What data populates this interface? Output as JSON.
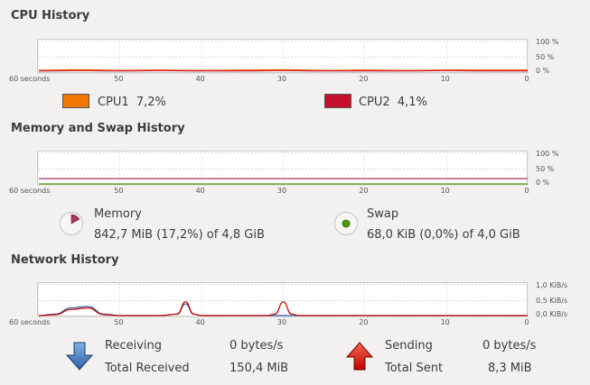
{
  "cpu": {
    "title": "CPU History",
    "y_labels": [
      "100 %",
      "50 %",
      "0 %"
    ],
    "x_labels": [
      "60 seconds",
      "50",
      "40",
      "30",
      "20",
      "10",
      "0"
    ],
    "cpus": [
      {
        "label": "CPU1",
        "value": "7,2%",
        "color": "#f07800"
      },
      {
        "label": "CPU2",
        "value": "4,1%",
        "color": "#c8102e"
      }
    ]
  },
  "memory": {
    "title": "Memory and Swap History",
    "y_labels": [
      "100 %",
      "50 %",
      "0 %"
    ],
    "x_labels": [
      "60 seconds",
      "50",
      "40",
      "30",
      "20",
      "10",
      "0"
    ],
    "memory_label": "Memory",
    "memory_value": "842,7 MiB (17,2%) of 4,8 GiB",
    "memory_fraction": 0.172,
    "memory_color": "#ad3463",
    "swap_label": "Swap",
    "swap_value": "68,0 KiB (0,0%) of 4,0 GiB",
    "swap_fraction": 0.0,
    "swap_color": "#4e9a06"
  },
  "network": {
    "title": "Network History",
    "y_labels": [
      "1,0 KiB/s",
      "0,5 KiB/s",
      "0,0 KiB/s"
    ],
    "x_labels": [
      "60 seconds",
      "50",
      "40",
      "30",
      "20",
      "10",
      "0"
    ],
    "receiving_label": "Receiving",
    "receiving_value": "0 bytes/s",
    "total_received_label": "Total Received",
    "total_received_value": "150,4 MiB",
    "sending_label": "Sending",
    "sending_value": "0 bytes/s",
    "total_sent_label": "Total Sent",
    "total_sent_value": "8,3 MiB",
    "receiving_color": "#2d5fa6",
    "sending_color": "#cc0000"
  },
  "chart_data": [
    {
      "type": "line",
      "title": "CPU History",
      "x": [
        60,
        55,
        50,
        45,
        40,
        35,
        30,
        25,
        20,
        15,
        10,
        5,
        0
      ],
      "ylim": [
        0,
        100
      ],
      "series": [
        {
          "name": "CPU1",
          "values": [
            6,
            8,
            6,
            7,
            6,
            7,
            8,
            6,
            7,
            6,
            7,
            7,
            7.2
          ]
        },
        {
          "name": "CPU2",
          "values": [
            4,
            5,
            4,
            5,
            4,
            4,
            5,
            4,
            4,
            4,
            5,
            4,
            4.1
          ]
        }
      ]
    },
    {
      "type": "line",
      "title": "Memory and Swap History",
      "x": [
        60,
        0
      ],
      "ylim": [
        0,
        100
      ],
      "series": [
        {
          "name": "Memory",
          "values": [
            17.2,
            17.2
          ]
        },
        {
          "name": "Swap",
          "values": [
            0,
            0
          ]
        }
      ]
    },
    {
      "type": "line",
      "title": "Network History",
      "x": [
        60,
        58,
        56,
        54,
        52,
        50,
        45,
        43,
        42,
        41,
        40,
        32,
        31,
        30,
        29,
        28,
        20,
        10,
        0
      ],
      "ylim": [
        0,
        1.0
      ],
      "series": [
        {
          "name": "Receiving",
          "values": [
            0,
            0.05,
            0.25,
            0.3,
            0.05,
            0,
            0,
            0.05,
            0.38,
            0.05,
            0,
            0,
            0,
            0,
            0,
            0,
            0,
            0,
            0
          ]
        },
        {
          "name": "Sending",
          "values": [
            0,
            0.03,
            0.2,
            0.25,
            0.03,
            0,
            0,
            0.05,
            0.45,
            0.05,
            0,
            0,
            0.05,
            0.45,
            0.05,
            0,
            0,
            0,
            0
          ]
        }
      ]
    }
  ]
}
